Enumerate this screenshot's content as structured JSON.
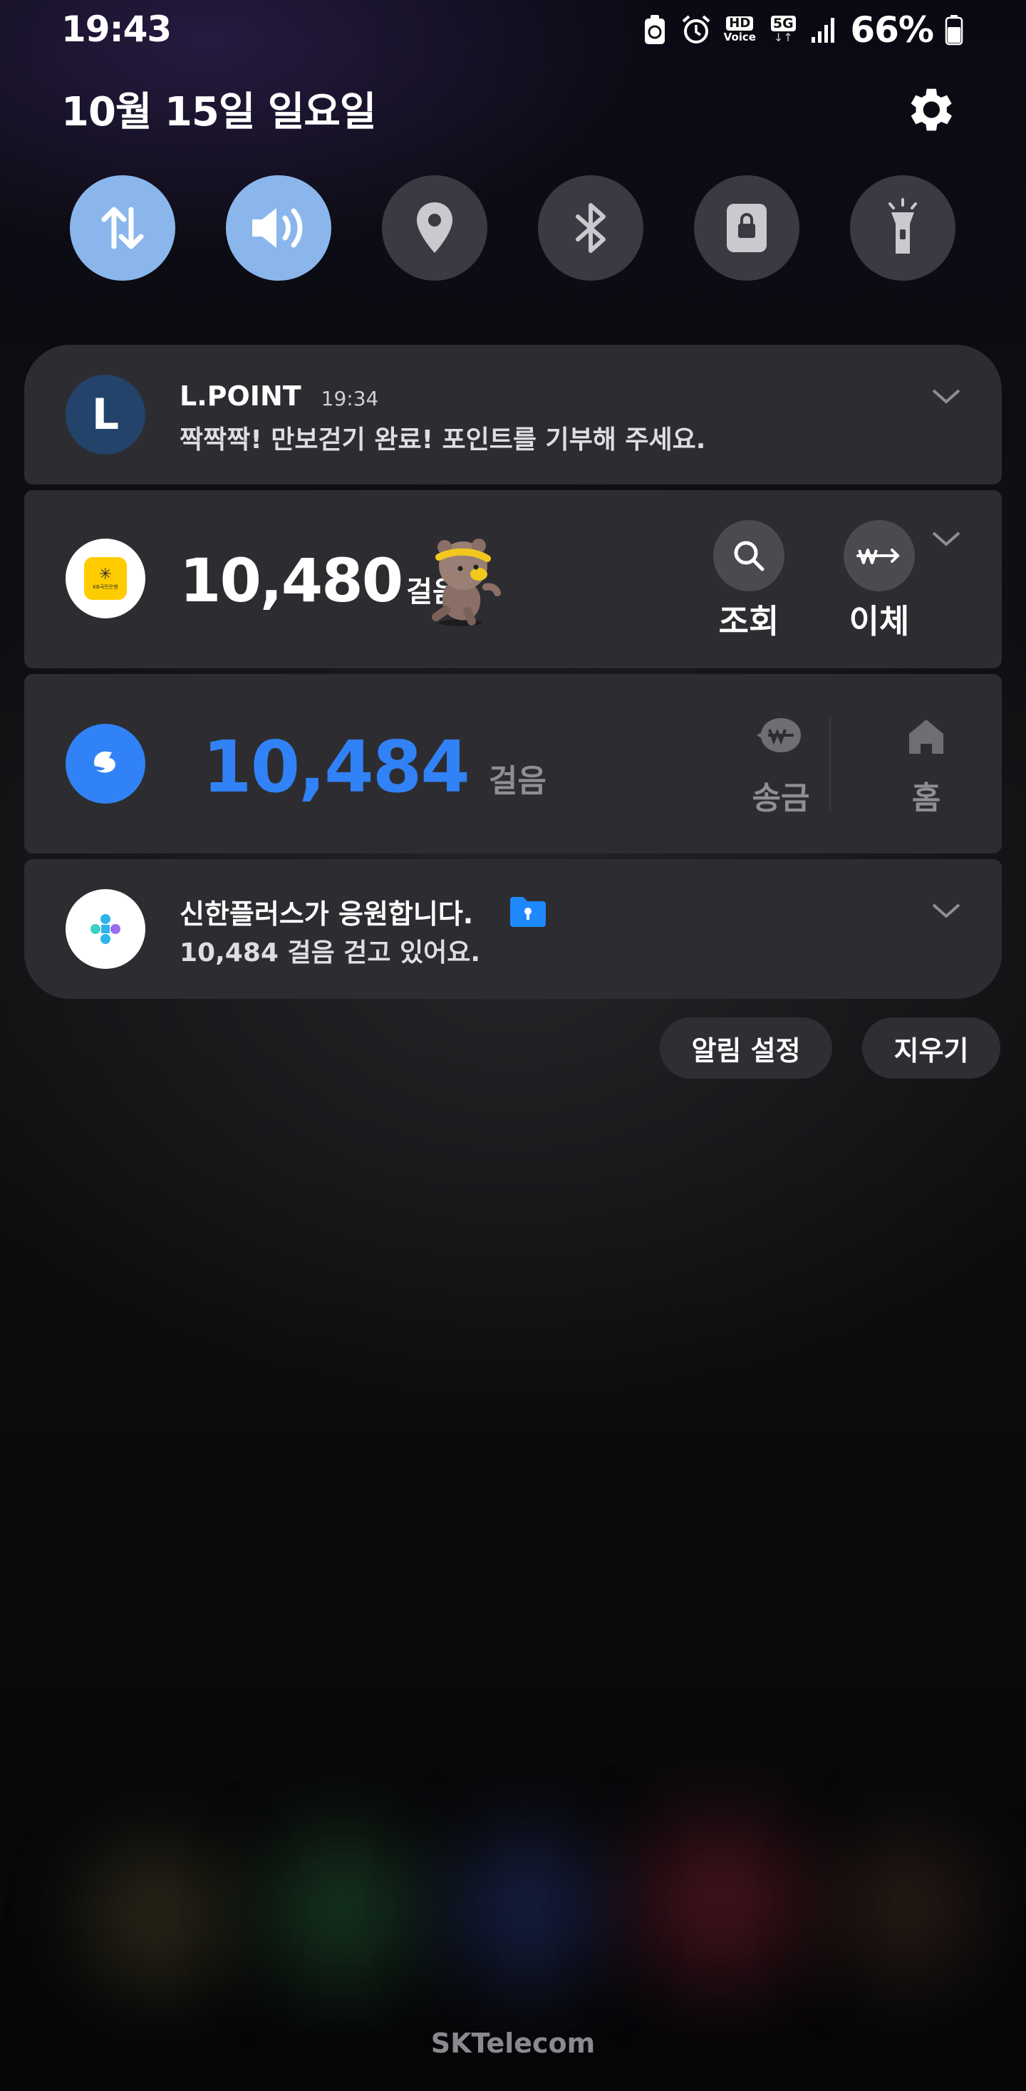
{
  "status_bar": {
    "time": "19:43",
    "icons": [
      "battery-saver-icon",
      "alarm-icon",
      "hd-voice-icon",
      "5g-icon",
      "signal-icon"
    ],
    "hd_top": "HD",
    "hd_bottom": "Voice",
    "network": "5G",
    "battery_percent": "66%",
    "battery_level": 0.66
  },
  "header": {
    "date": "10월 15일 일요일",
    "settings_icon": "gear-icon"
  },
  "quick_toggles": [
    {
      "name": "mobile-data",
      "icon": "data-arrows-icon",
      "active": true
    },
    {
      "name": "sound",
      "icon": "speaker-icon",
      "active": true
    },
    {
      "name": "location",
      "icon": "location-pin-icon",
      "active": false
    },
    {
      "name": "bluetooth",
      "icon": "bluetooth-icon",
      "active": false
    },
    {
      "name": "rotation-lock",
      "icon": "lock-icon",
      "active": false
    },
    {
      "name": "flashlight",
      "icon": "flashlight-icon",
      "active": false
    }
  ],
  "notifications": {
    "lpoint": {
      "icon_letter": "L",
      "app": "L.POINT",
      "time": "19:34",
      "message": "짝짝짝! 만보걷기 완료! 포인트를 기부해 주세요."
    },
    "kb": {
      "logo_text": "KB국민은행",
      "steps": "10,480",
      "steps_unit": "걸음",
      "action1_label": "조회",
      "action2_label": "이체"
    },
    "toss": {
      "steps": "10,484",
      "steps_unit": "걸음",
      "action1_label": "송금",
      "action2_label": "홈"
    },
    "shinhan": {
      "title": "신한플러스가 응원합니다.",
      "message": "10,484 걸음 걷고 있어요."
    }
  },
  "footer_buttons": {
    "settings_label": "알림 설정",
    "clear_label": "지우기"
  },
  "carrier": "SKTelecom",
  "colors": {
    "toggle_on": "#8ab6ec",
    "toggle_off": "#3a3a43",
    "card_bg": "#2d2d31",
    "toss_blue": "#3182f6",
    "kb_yellow": "#ffcc00",
    "lpoint_navy": "#23436b"
  }
}
